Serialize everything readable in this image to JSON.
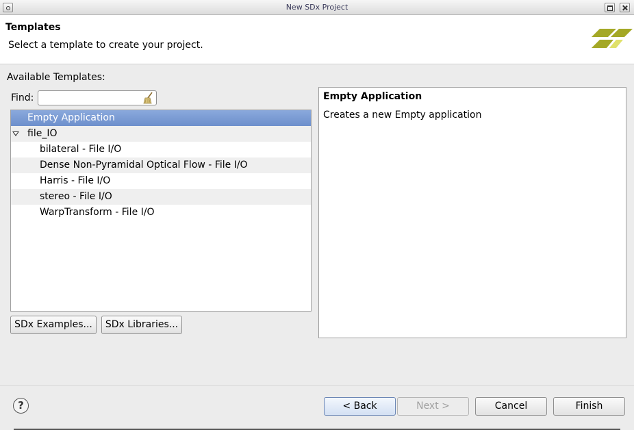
{
  "window": {
    "title": "New SDx Project"
  },
  "header": {
    "title": "Templates",
    "subtitle": "Select a template to create your project."
  },
  "templates": {
    "available_label": "Available Templates:",
    "find_label": "Find:",
    "find_value": "",
    "tree": [
      {
        "label": "Empty Application",
        "level": 0,
        "selected": true
      },
      {
        "label": "file_IO",
        "level": 0,
        "expanded": true
      },
      {
        "label": "bilateral - File I/O",
        "level": 1
      },
      {
        "label": "Dense Non-Pyramidal Optical Flow - File I/O",
        "level": 1
      },
      {
        "label": "Harris - File I/O",
        "level": 1
      },
      {
        "label": "stereo - File I/O",
        "level": 1
      },
      {
        "label": "WarpTransform - File I/O",
        "level": 1
      }
    ],
    "examples_button": "SDx Examples...",
    "libraries_button": "SDx Libraries..."
  },
  "description": {
    "title": "Empty Application",
    "text": "Creates a new Empty application"
  },
  "footer": {
    "help_icon": "question-mark-icon",
    "help_glyph": "?",
    "back": "< Back",
    "next": "Next >",
    "cancel": "Cancel",
    "finish": "Finish"
  },
  "colors": {
    "selection": "#7396d2",
    "logo": "#a4a826"
  }
}
